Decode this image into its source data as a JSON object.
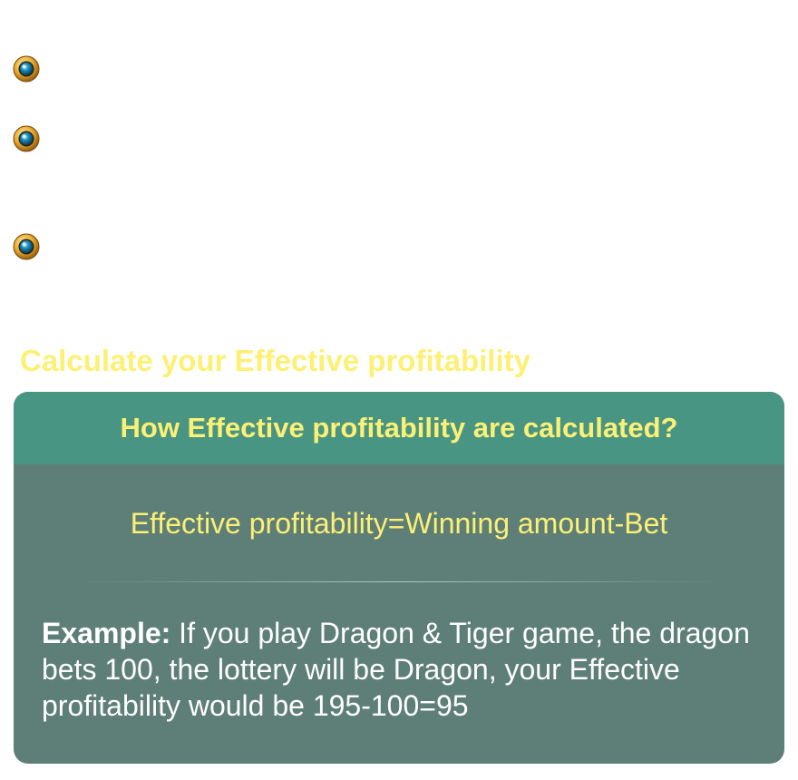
{
  "colors": {
    "title_yellow": "#fcf075",
    "card_header_bg": "#489584",
    "card_body_bg": "#5e7f77",
    "body_text": "#ffffff",
    "bullet_gold": "#e0a22a",
    "bullet_teal": "#1a8ab8"
  },
  "bullets": [
    {
      "icon": "gold-gem-bullet-icon"
    },
    {
      "icon": "gold-gem-bullet-icon"
    },
    {
      "icon": "gold-gem-bullet-icon"
    }
  ],
  "section": {
    "title": "Calculate your Effective profitability"
  },
  "card": {
    "header": "How Effective profitability are calculated?",
    "formula": "Effective profitability=Winning amount-Bet",
    "example_label": "Example:",
    "example_text": " If you play Dragon & Tiger game, the dragon bets 100, the lottery will be Dragon, your Effective profitability would be 195-100=95"
  }
}
